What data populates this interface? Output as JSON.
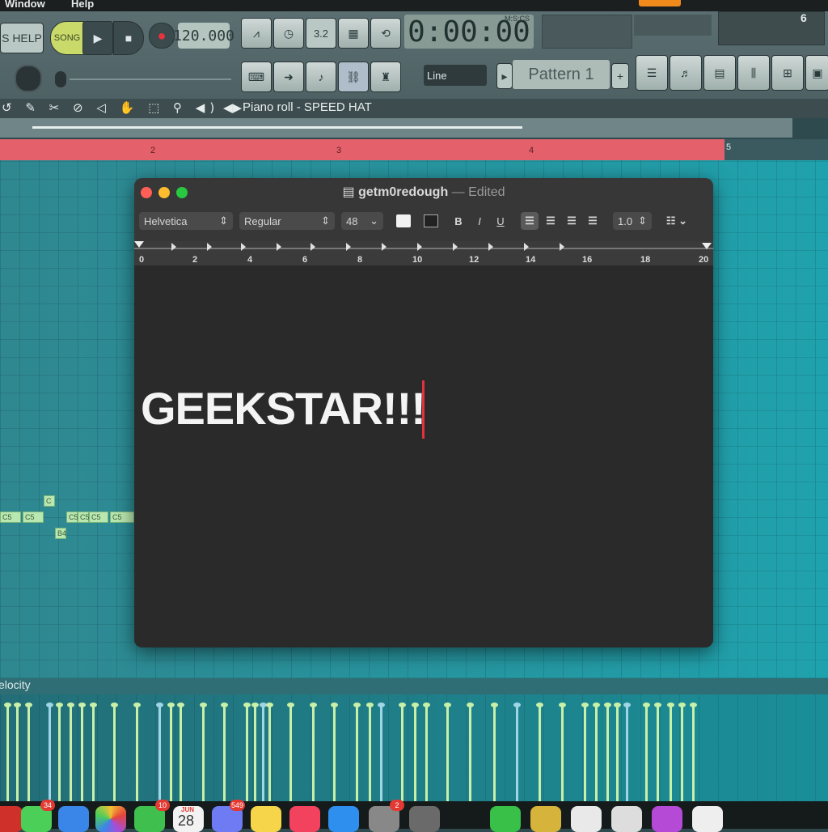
{
  "menubar": {
    "items": [
      "Window",
      "Help"
    ]
  },
  "fl": {
    "help_label": "S HELP",
    "song_label": "SONG",
    "bpm": "120.000",
    "time": "0:00:00",
    "time_format": "M:S:CS",
    "counter": "6",
    "beat_label": "3.2",
    "line_mode": "Line",
    "pattern": "Pattern 1",
    "piano_roll_title": "Piano roll - SPEED HAT",
    "timeline_numbers": [
      "2",
      "3",
      "4",
      "5"
    ],
    "velocity_label": "elocity",
    "notes": [
      "C5",
      "C5",
      "C",
      "C5",
      "C5",
      "C5",
      "C5",
      "B4"
    ]
  },
  "textedit": {
    "title": "getm0redough",
    "edited": "— Edited",
    "font": "Helvetica",
    "style": "Regular",
    "size": "48",
    "bold": "B",
    "italic": "I",
    "underline": "U",
    "spacing": "1.0",
    "ruler_numbers": [
      "0",
      "2",
      "4",
      "6",
      "8",
      "10",
      "12",
      "14",
      "16",
      "18",
      "20"
    ],
    "content": "GEEKSTAR!!!"
  },
  "dock": {
    "badges": [
      "34",
      "10",
      "549",
      "2"
    ],
    "calendar_month": "JUN",
    "calendar_day": "28"
  },
  "colors": {
    "timeline": "#e4606a",
    "note": "#b9e7b0",
    "velocity_stem": "#c8f0a8",
    "caret": "#e0333d"
  }
}
